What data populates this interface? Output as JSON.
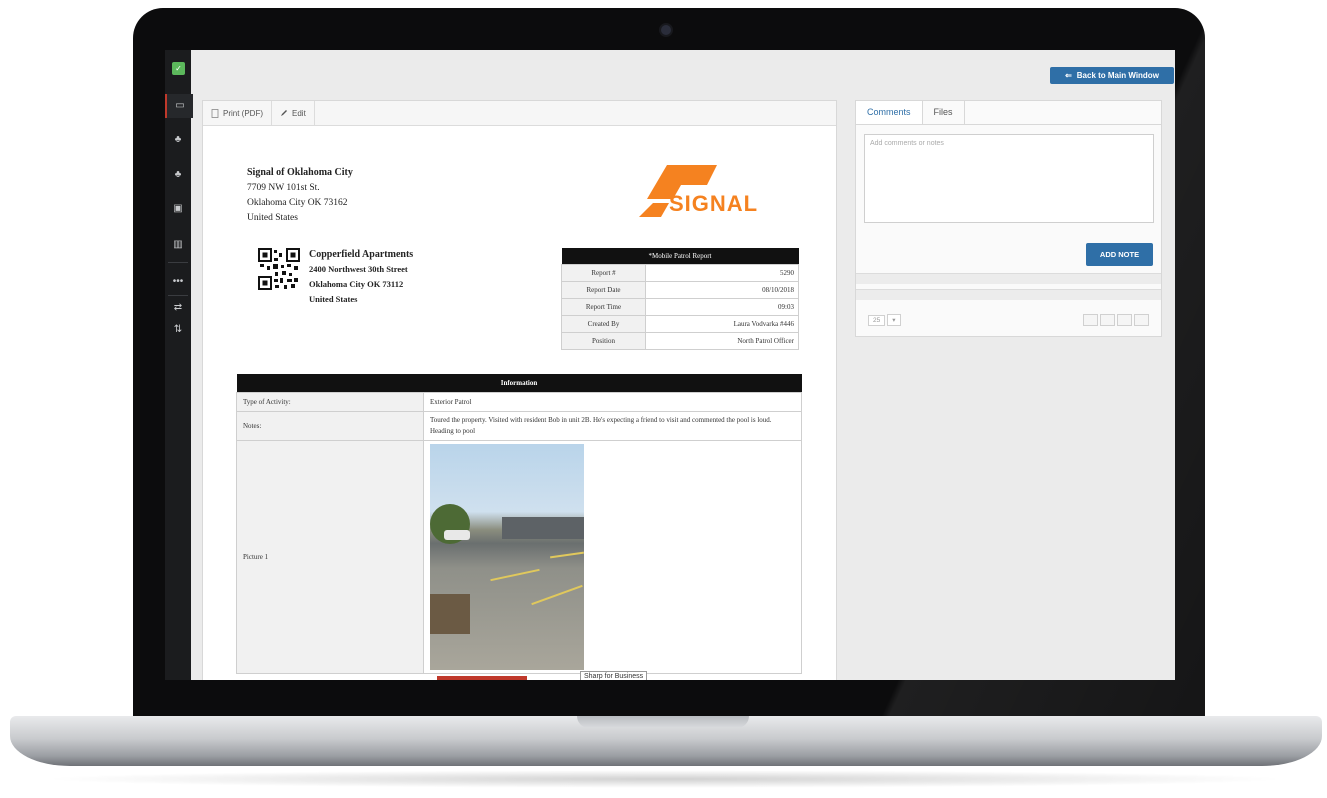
{
  "app": {
    "logo_glyph": "✓",
    "back_button_icon": "⇐",
    "back_button_label": "Back to Main Window"
  },
  "sidebar": {
    "items": [
      {
        "icon": "monitor-icon",
        "glyph": "▭"
      },
      {
        "icon": "sitemap-icon",
        "glyph": "♣"
      },
      {
        "icon": "sitemap-icon",
        "glyph": "♣"
      },
      {
        "icon": "calendar-icon",
        "glyph": "▣"
      },
      {
        "icon": "chart-icon",
        "glyph": "▥"
      },
      {
        "icon": "more-icon",
        "glyph": "•••"
      },
      {
        "icon": "switch-icon",
        "glyph": "⇄"
      },
      {
        "icon": "sort-icon",
        "glyph": "⇅"
      }
    ]
  },
  "toolbar": {
    "print_label": "Print (PDF)",
    "edit_label": "Edit"
  },
  "report": {
    "company_name": "Signal of Oklahoma City",
    "company_address_1": "7709 NW 101st St.",
    "company_address_2": "Oklahoma City OK 73162",
    "company_country": "United States",
    "logo_text": "SIGNAL",
    "site_name": "Copperfield Apartments",
    "site_address_1": "2400 Northwest 30th Street",
    "site_address_2": "Oklahoma City OK 73112",
    "site_country": "United States",
    "patrol_title": "*Mobile Patrol Report",
    "patrol_rows": [
      {
        "label": "Report #",
        "value": "5290"
      },
      {
        "label": "Report Date",
        "value": "08/10/2018"
      },
      {
        "label": "Report Time",
        "value": "09:03"
      },
      {
        "label": "Created By",
        "value": "Laura Vodvarka #446"
      },
      {
        "label": "Position",
        "value": "North Patrol Officer"
      }
    ],
    "info_title": "Information",
    "info_rows": {
      "activity_label": "Type of Activity:",
      "activity_value": "Exterior Patrol",
      "notes_label": "Notes:",
      "notes_value": "Toured the property. Visited with resident Bob in unit 2B. He's expecting a friend to visit and commented the pool is loud. Heading to pool",
      "picture_label": "Picture 1"
    },
    "tooltip_text": "Sharp for Business"
  },
  "comments": {
    "tab_comments": "Comments",
    "tab_files": "Files",
    "notes_placeholder": "Add comments or notes",
    "add_note_label": "ADD NOTE",
    "page_size": "25",
    "page_size_caret": "▾"
  },
  "colors": {
    "accent": "#2f6fa7",
    "brand_orange": "#f58220",
    "sidebar_bg": "#1b1c1e",
    "active_marker": "#c0392b"
  }
}
